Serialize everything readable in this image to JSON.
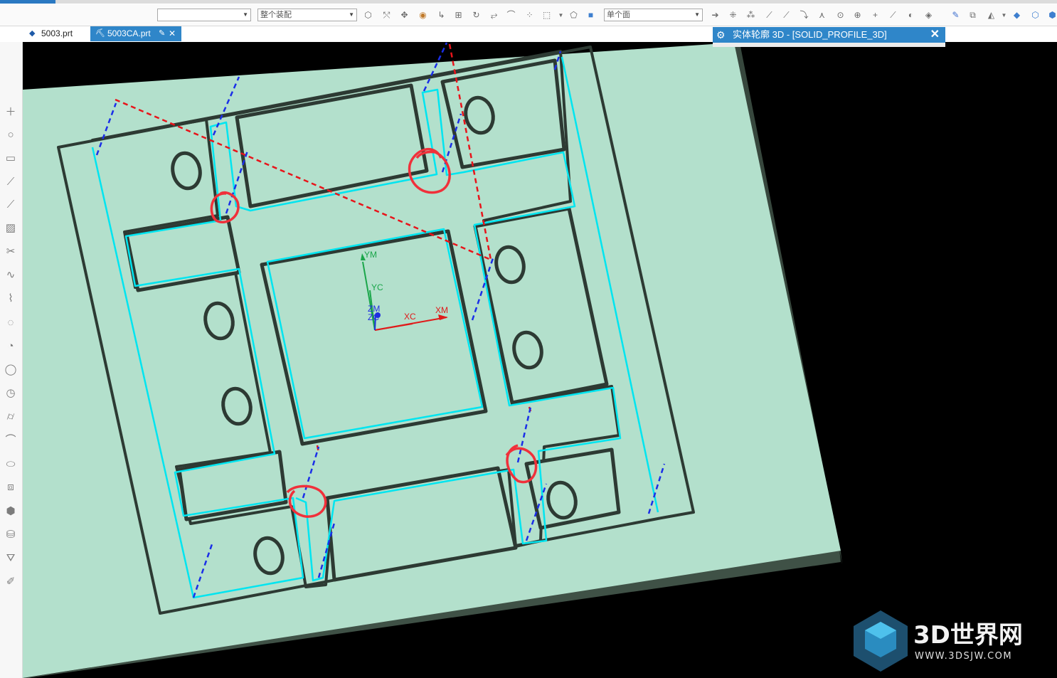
{
  "toolbar": {
    "combo_1_value": "",
    "combo_2_value": "整个装配",
    "combo_3_value": "单个面"
  },
  "tabs": [
    {
      "label": "5003.prt",
      "active": false
    },
    {
      "label": "5003CA.prt",
      "active": true
    }
  ],
  "dialog": {
    "title": "实体轮廓 3D - [SOLID_PROFILE_3D]"
  },
  "viewport": {
    "axis_labels": {
      "ym": "YM",
      "yc": "YC",
      "zm": "ZM",
      "zc": "ZC",
      "xc": "XC",
      "xm": "XM"
    }
  },
  "watermark": {
    "brand": "3D世界网",
    "url": "WWW.3DSJW.COM"
  },
  "colors": {
    "part_face": "#b3e0cc",
    "part_side": "#3f5146",
    "toolpath": "#00e5f0",
    "engage_dash": "#1a2ee8",
    "rapid_dash": "#e8141a",
    "annotation_circle": "#f0303a",
    "active_tab": "#2f86c9"
  }
}
